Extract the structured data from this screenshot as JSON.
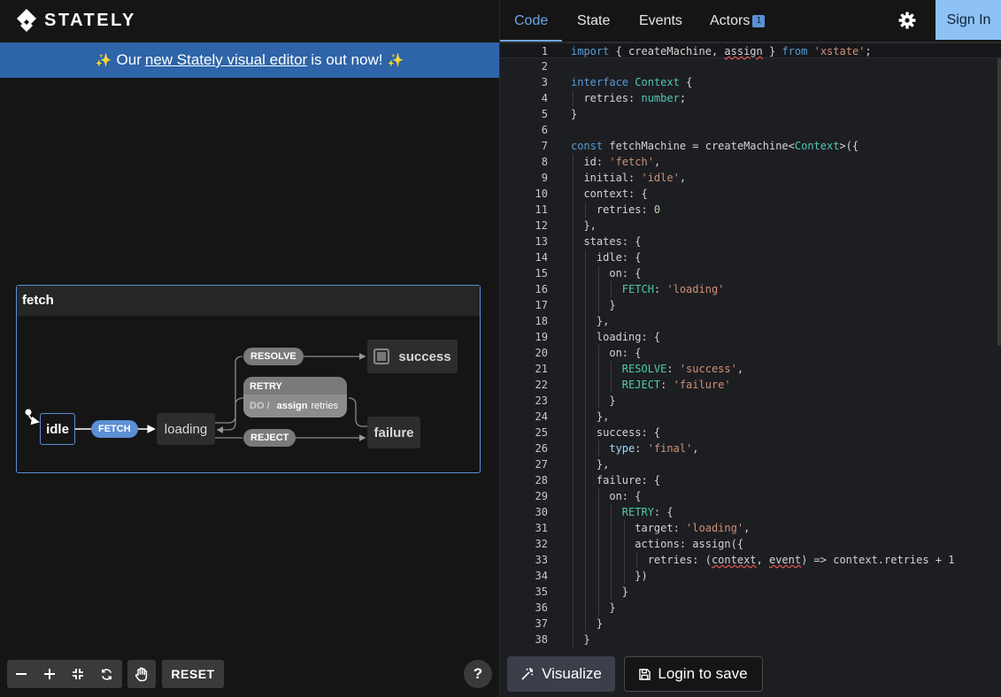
{
  "app": {
    "name": "STATELY",
    "banner": {
      "before": "Our",
      "link": "new Stately visual editor",
      "after": "is out now!",
      "sparkle": "✨"
    }
  },
  "machine": {
    "id": "fetch",
    "states": {
      "idle": "idle",
      "loading": "loading",
      "success": "success",
      "failure": "failure"
    },
    "events": {
      "fetch": "FETCH",
      "resolve": "RESOLVE",
      "retry": "RETRY",
      "retry_do": "DO /",
      "retry_action": "assign",
      "retry_action_arg": "retries",
      "reject": "REJECT"
    }
  },
  "canvas_controls": {
    "reset": "RESET",
    "help": "?"
  },
  "tabs": [
    {
      "label": "Code"
    },
    {
      "label": "State"
    },
    {
      "label": "Events"
    },
    {
      "label": "Actors",
      "badge": "1"
    }
  ],
  "signin": "Sign In",
  "editor": {
    "line_numbers": [
      "1",
      "2",
      "3",
      "4",
      "5",
      "6",
      "7",
      "8",
      "9",
      "10",
      "11",
      "12",
      "13",
      "14",
      "15",
      "16",
      "17",
      "18",
      "19",
      "20",
      "21",
      "22",
      "23",
      "24",
      "25",
      "26",
      "27",
      "28",
      "29",
      "30",
      "31",
      "32",
      "33",
      "34",
      "35",
      "36",
      "37",
      "38"
    ],
    "code": [
      "import { createMachine, assign } from 'xstate';",
      "",
      "interface Context {",
      "  retries: number;",
      "}",
      "",
      "const fetchMachine = createMachine<Context>({",
      "  id: 'fetch',",
      "  initial: 'idle',",
      "  context: {",
      "    retries: 0",
      "  },",
      "  states: {",
      "    idle: {",
      "      on: {",
      "        FETCH: 'loading'",
      "      }",
      "    },",
      "    loading: {",
      "      on: {",
      "        RESOLVE: 'success',",
      "        REJECT: 'failure'",
      "      }",
      "    },",
      "    success: {",
      "      type: 'final',",
      "    },",
      "    failure: {",
      "      on: {",
      "        RETRY: {",
      "          target: 'loading',",
      "          actions: assign({",
      "            retries: (context, event) => context.retries + 1",
      "          })",
      "        }",
      "      }",
      "    }",
      "  }"
    ]
  },
  "buttons": {
    "visualize": "Visualize",
    "login_to_save": "Login to save"
  },
  "colors": {
    "accent": "#5b8fd6",
    "banner": "#2e64a8",
    "signin": "#8ec2f5",
    "tab_active": "#6ea6e6"
  }
}
